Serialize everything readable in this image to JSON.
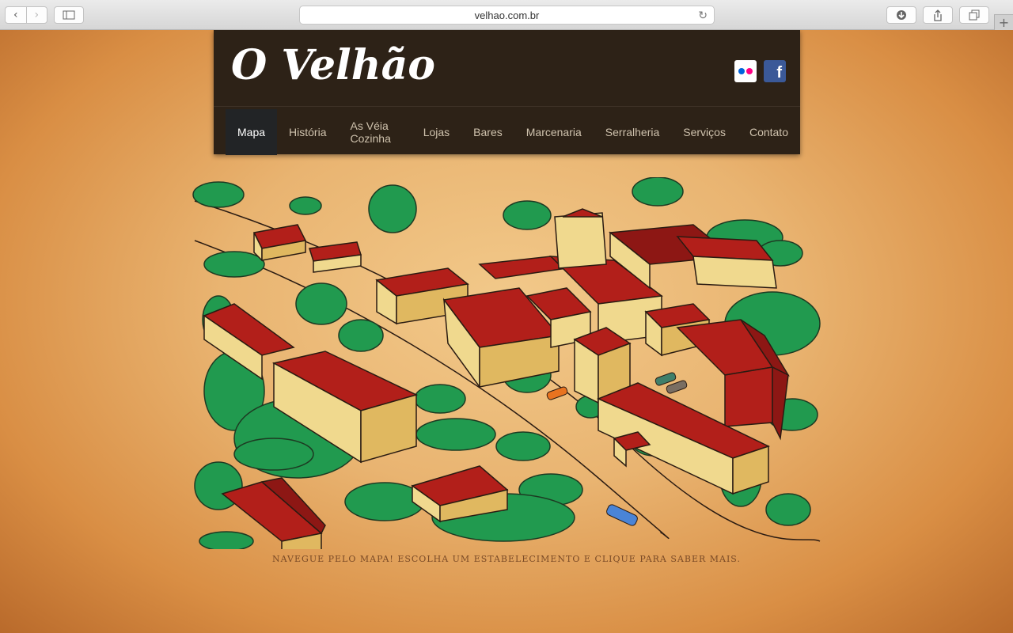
{
  "browser": {
    "url": "velhao.com.br",
    "icons": [
      "back-icon",
      "forward-icon",
      "sidebar-icon",
      "reload-icon",
      "download-icon",
      "share-icon",
      "tabs-icon",
      "new-tab-icon"
    ]
  },
  "site": {
    "logo": "O Velhão",
    "social": [
      "flickr-icon",
      "facebook-icon"
    ],
    "facebook_glyph": "f",
    "menu": [
      {
        "label": "Mapa",
        "active": true
      },
      {
        "label": "História"
      },
      {
        "label": "As Véia Cozinha"
      },
      {
        "label": "Lojas"
      },
      {
        "label": "Bares"
      },
      {
        "label": "Marcenaria"
      },
      {
        "label": "Serralheria"
      },
      {
        "label": "Serviços"
      },
      {
        "label": "Contato"
      }
    ],
    "caption": "NAVEGUE PELO MAPA! ESCOLHA UM ESTABELECIMENTO E CLIQUE PARA SABER MAIS."
  },
  "colors": {
    "header_bg": "#2d2217",
    "roof_red": "#b21f1a",
    "wall_cream": "#f0d98e",
    "tree_green": "#219a4f",
    "parchment": "#e9b471"
  }
}
